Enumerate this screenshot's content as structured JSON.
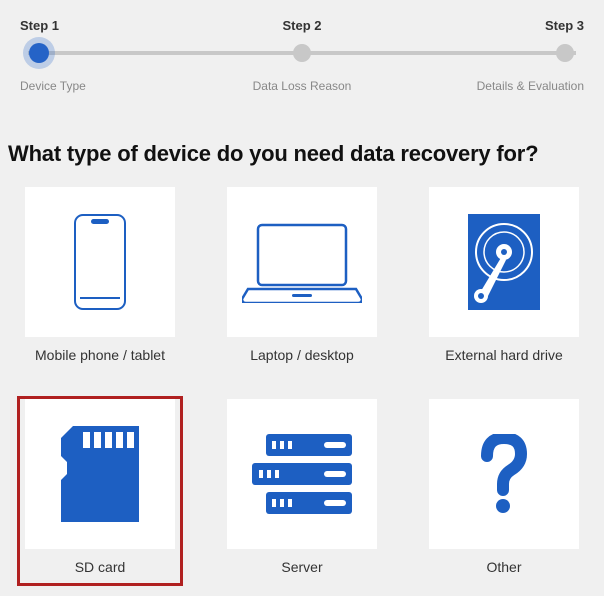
{
  "stepper": {
    "steps": [
      {
        "top": "Step 1",
        "bottom": "Device Type",
        "active": true
      },
      {
        "top": "Step 2",
        "bottom": "Data Loss Reason",
        "active": false
      },
      {
        "top": "Step 3",
        "bottom": "Details & Evaluation",
        "active": false
      }
    ]
  },
  "heading": "What type of device do you need data recovery for?",
  "tiles": [
    {
      "id": "mobile",
      "label": "Mobile phone / tablet",
      "highlighted": false
    },
    {
      "id": "laptop",
      "label": "Laptop / desktop",
      "highlighted": false
    },
    {
      "id": "external",
      "label": "External hard drive",
      "highlighted": false
    },
    {
      "id": "sdcard",
      "label": "SD card",
      "highlighted": true
    },
    {
      "id": "server",
      "label": "Server",
      "highlighted": false
    },
    {
      "id": "other",
      "label": "Other",
      "highlighted": false
    }
  ]
}
